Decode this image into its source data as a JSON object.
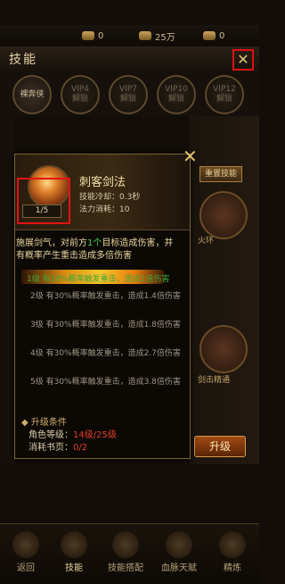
{
  "topbar": {
    "currency1": "0",
    "currency2": "25万",
    "currency3": "0"
  },
  "header": {
    "title": "技能"
  },
  "vip_slots": [
    {
      "line1": "",
      "line2": "裸奔侠"
    },
    {
      "line1": "VIP4",
      "line2": "解锁"
    },
    {
      "line1": "VIP7",
      "line2": "解锁"
    },
    {
      "line1": "VIP10",
      "line2": "解锁"
    },
    {
      "line1": "VIP12",
      "line2": "解锁"
    }
  ],
  "side": {
    "skill_button": "重置技能",
    "label1": "火环",
    "label2": "剑击精通"
  },
  "upgrade_button": "升级",
  "popup": {
    "skill_name": "刺客剑法",
    "cooldown": "技能冷却：0.3秒",
    "mana": "法力消耗：10",
    "level_tag": "1/5",
    "desc_a": "施展剑气，对前方",
    "desc_b": "1个",
    "desc_c": "目标造成伤害，并有概率产生重击造成多倍伤害",
    "lv1": "1级 有30%概率触发重击，造成1倍伤害",
    "lv2": "2级 有30%概率触发重击，造成1.4倍伤害",
    "lv3": "3级 有30%概率触发重击，造成1.8倍伤害",
    "lv4": "4级 有30%概率触发重击，造成2.7倍伤害",
    "lv5": "5级 有30%概率触发重击，造成3.8倍伤害",
    "req_title": "升级条件",
    "req_level_label": "角色等级：",
    "req_level_value": "14级/25级",
    "req_pages_label": "消耗书页：",
    "req_pages_value": "0/2"
  },
  "nav": [
    {
      "label": "返回"
    },
    {
      "label": "技能"
    },
    {
      "label": "技能搭配"
    },
    {
      "label": "血脉天赋"
    },
    {
      "label": "精炼"
    }
  ]
}
